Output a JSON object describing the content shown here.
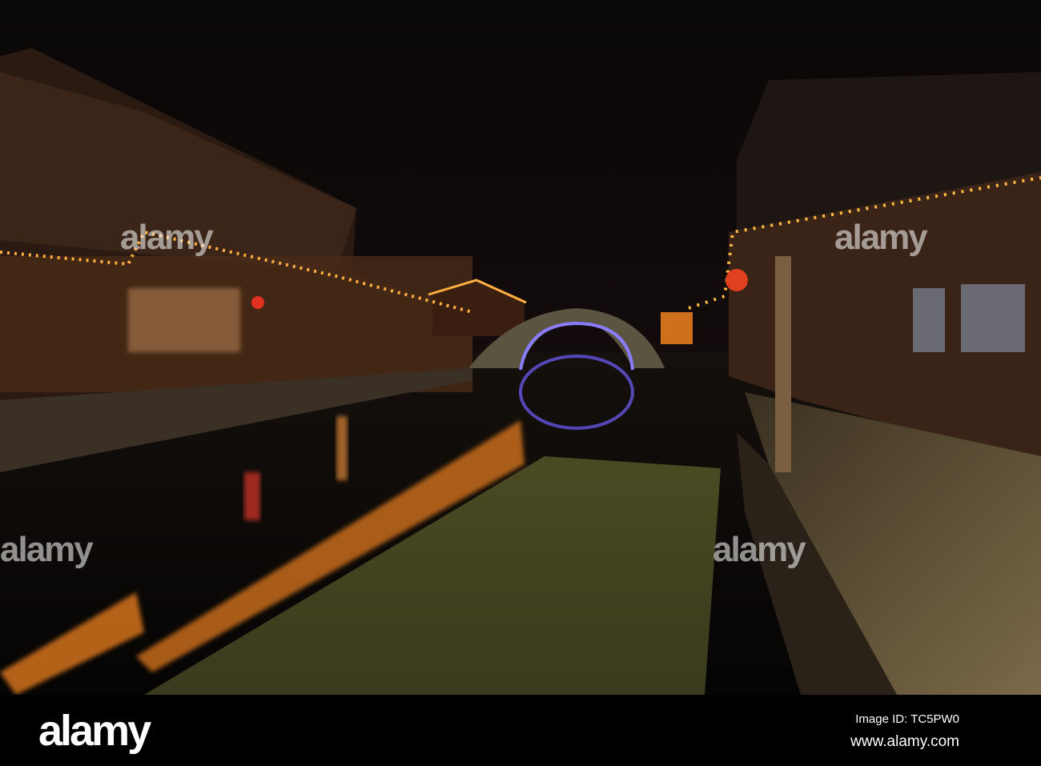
{
  "photo": {
    "subject": "canal-town-night",
    "colors": {
      "sky": "#0d0808",
      "lights": "#ff9a2a",
      "bridge_glow": "#8a7cff",
      "grass": "#5a5a2a",
      "stone": "#6b5a3a"
    }
  },
  "watermark": {
    "text": "alamy",
    "mark": "a"
  },
  "footer": {
    "logo": "alamy",
    "image_id": "Image ID: TC5PW0",
    "website": "www.alamy.com"
  }
}
